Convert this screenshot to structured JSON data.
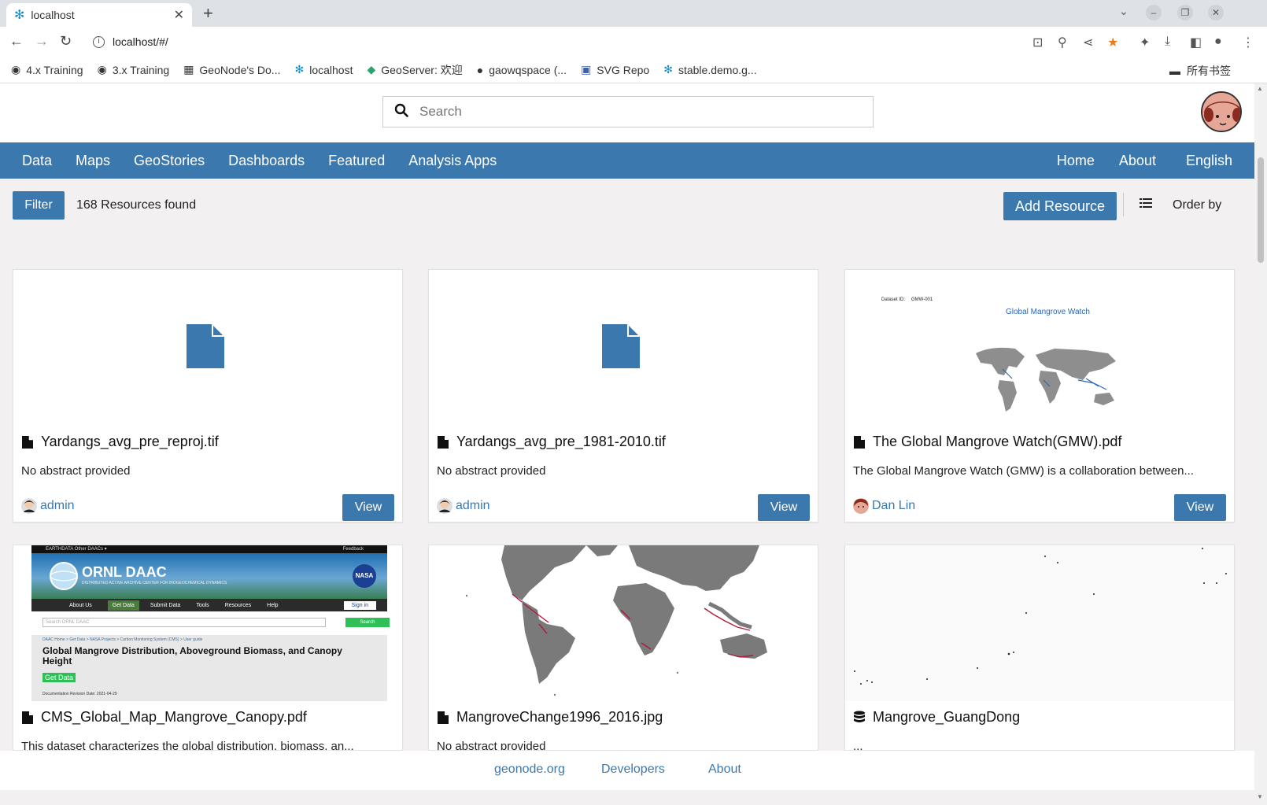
{
  "browser": {
    "tab_title": "localhost",
    "url": "localhost/#/",
    "bookmarks": [
      "4.x Training",
      "3.x Training",
      "GeoNode's Do...",
      "localhost",
      "GeoServer: 欢迎",
      "gaowqspace (...",
      "SVG Repo",
      "stable.demo.g..."
    ],
    "bookmarks_folder": "所有书签"
  },
  "header": {
    "search_placeholder": "Search"
  },
  "nav": {
    "left": [
      "Data",
      "Maps",
      "GeoStories",
      "Dashboards",
      "Featured",
      "Analysis Apps"
    ],
    "right": [
      "Home",
      "About",
      "English"
    ]
  },
  "toolbar": {
    "filter_label": "Filter",
    "resources_found": "168 Resources found",
    "add_resource_label": "Add Resource",
    "order_by_label": "Order by"
  },
  "cards": [
    {
      "title": "Yardangs_avg_pre_reproj.tif",
      "abstract": "No abstract provided",
      "owner": "admin",
      "view_label": "View",
      "type_icon": "file-icon",
      "thumb": "file-placeholder"
    },
    {
      "title": "Yardangs_avg_pre_1981-2010.tif",
      "abstract": "No abstract provided",
      "owner": "admin",
      "view_label": "View",
      "type_icon": "file-icon",
      "thumb": "file-placeholder"
    },
    {
      "title": "The Global Mangrove Watch(GMW).pdf",
      "abstract": "The Global Mangrove Watch (GMW) is a collaboration between...",
      "owner": "Dan Lin",
      "view_label": "View",
      "type_icon": "file-icon",
      "thumb": "gmw-map"
    },
    {
      "title": "CMS_Global_Map_Mangrove_Canopy.pdf",
      "abstract": "This dataset characterizes the global distribution, biomass, an...",
      "type_icon": "file-icon",
      "thumb": "ornl-page"
    },
    {
      "title": "MangroveChange1996_2016.jpg",
      "abstract": "No abstract provided",
      "type_icon": "file-icon",
      "thumb": "world-map"
    },
    {
      "title": "Mangrove_GuangDong",
      "abstract": "...",
      "type_icon": "database-icon",
      "thumb": "sparse-points"
    }
  ],
  "thumbs": {
    "gmw": {
      "dataset_id_label": "Dataset ID:",
      "dataset_id": "GMW-001",
      "title": "Global Mangrove Watch"
    },
    "ornl": {
      "topbar": "EARTHDATA    Other DAACs ▾",
      "feedback": "Feedback",
      "brand": "ORNL DAAC",
      "brand_sub": "DISTRIBUTED ACTIVE ARCHIVE CENTER FOR BIOGEOCHEMICAL DYNAMICS",
      "nasa": "NASA",
      "menu": [
        "About Us",
        "Get Data",
        "Submit Data",
        "Tools",
        "Resources",
        "Help"
      ],
      "sign_in": "Sign in",
      "search_placeholder": "Search ORNL DAAC",
      "search_btn": "Search",
      "breadcrumb": "DAAC Home > Get Data > NASA Projects > Carbon Monitoring System (CMS) > User guide",
      "page_title": "Global Mangrove Distribution, Aboveground Biomass, and Canopy Height",
      "get_data": "Get Data",
      "doc_revision": "Documentation Revision Date: 2021-04-29"
    }
  },
  "footer": {
    "links": [
      "geonode.org",
      "Developers",
      "About"
    ]
  },
  "colors": {
    "primary": "#3b78ad",
    "page_bg": "#f2f0f0"
  }
}
